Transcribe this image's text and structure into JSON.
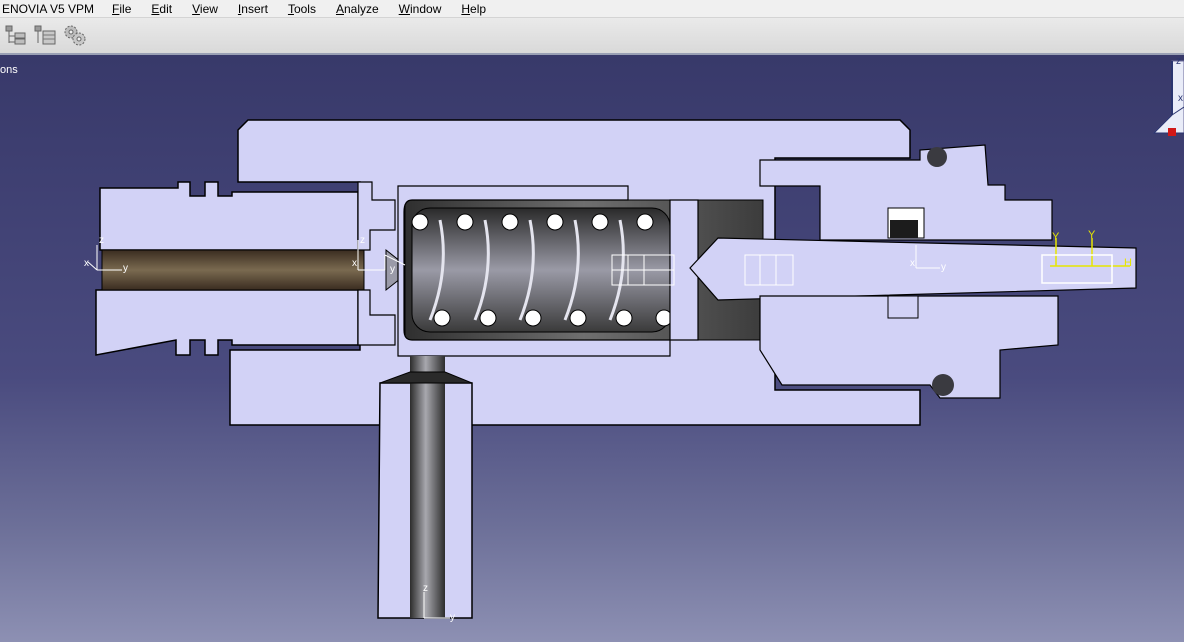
{
  "window": {
    "app_title": "ENOVIA V5 VPM"
  },
  "menu": [
    {
      "pre": "",
      "key": "F",
      "rest": "ile"
    },
    {
      "pre": "",
      "key": "E",
      "rest": "dit"
    },
    {
      "pre": "",
      "key": "V",
      "rest": "iew"
    },
    {
      "pre": "",
      "key": "I",
      "rest": "nsert"
    },
    {
      "pre": "",
      "key": "T",
      "rest": "ools"
    },
    {
      "pre": "",
      "key": "A",
      "rest": "nalyze"
    },
    {
      "pre": "",
      "key": "W",
      "rest": "indow"
    },
    {
      "pre": "",
      "key": "H",
      "rest": "elp"
    }
  ],
  "toolbar": {
    "icons": [
      "product-structure-icon",
      "assembly-icon",
      "gears-icon"
    ]
  },
  "tree": {
    "partial_label": "ons"
  },
  "compass": {
    "z_label": "z",
    "x_label": "x"
  },
  "axes": {
    "left": {
      "x": "x",
      "y": "y",
      "z": "z"
    },
    "middle": {
      "x": "x",
      "y": "y",
      "z": "z"
    },
    "center_right": {
      "x": "x",
      "y": "y"
    },
    "bottom": {
      "z": "z",
      "y": "y"
    },
    "right_y1": "Y",
    "right_y2": "Y",
    "right_h": "H"
  },
  "colors": {
    "part_fill": "#d2d2f6",
    "outline": "#000000",
    "viewport_top": "#38396a",
    "viewport_bottom": "#8d90b3",
    "highlight_yellow": "#e6e600"
  }
}
